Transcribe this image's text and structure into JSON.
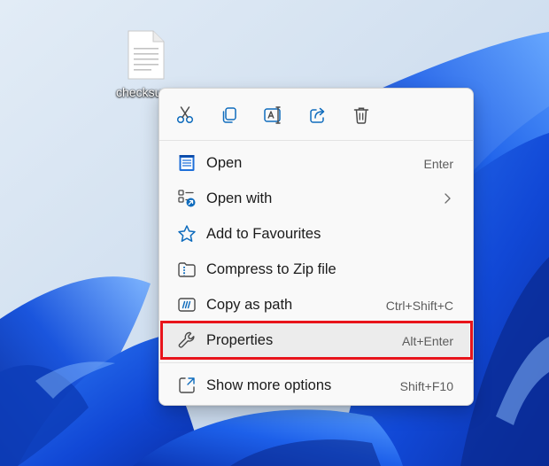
{
  "desktop": {
    "file_label": "checksu"
  },
  "context_menu": {
    "actions": [
      {
        "icon": "scissors-icon",
        "tooltip": "Cut"
      },
      {
        "icon": "copy-icon",
        "tooltip": "Copy"
      },
      {
        "icon": "rename-icon",
        "tooltip": "Rename"
      },
      {
        "icon": "share-icon",
        "tooltip": "Share"
      },
      {
        "icon": "trash-icon",
        "tooltip": "Delete"
      }
    ],
    "items": [
      {
        "label": "Open",
        "shortcut": "Enter",
        "icon": "notepad-icon"
      },
      {
        "label": "Open with",
        "shortcut": "",
        "icon": "open-with-icon",
        "submenu": true
      },
      {
        "label": "Add to Favourites",
        "shortcut": "",
        "icon": "star-icon"
      },
      {
        "label": "Compress to Zip file",
        "shortcut": "",
        "icon": "zip-folder-icon"
      },
      {
        "label": "Copy as path",
        "shortcut": "Ctrl+Shift+C",
        "icon": "copy-path-icon"
      },
      {
        "label": "Properties",
        "shortcut": "Alt+Enter",
        "icon": "wrench-icon"
      },
      {
        "label": "Show more options",
        "shortcut": "Shift+F10",
        "icon": "show-more-icon"
      }
    ]
  },
  "colors": {
    "accent": "#0f6cbd",
    "highlight": "#e8141b",
    "wallpaper_blue": "#1a56e0"
  }
}
